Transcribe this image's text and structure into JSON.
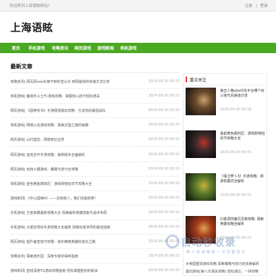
{
  "topbar": {
    "welcome": "欢迎来到上海语眩网站！",
    "links": [
      "注册",
      "|",
      "登录"
    ]
  },
  "site": {
    "name": "上海语眩"
  },
  "nav": [
    "首页",
    "手机游戏",
    "攻略资讯",
    "网页游戏",
    "游戏新闻",
    "单机游戏"
  ],
  "articles_section": {
    "title": "最新文章",
    "items": [
      {
        "title": "攻略资讯| 网页原neo先审不到你怎么办 到网最快的快速方法分享",
        "date": "2024-09-30 09:33"
      },
      {
        "title": "单机游戏| 魔塔环斗士FC游戏攻略：掌握核心技巧轻松通关",
        "date": "2024-09-30 09:33"
      },
      {
        "title": "网页游戏| 《圆神你书》手游网游激玩攻略：打造你的最强战队",
        "date": "2024-09-30 09:33"
      },
      {
        "title": "单机游戏| 网络火友游戏攻略：探索次盟之旅的秘籍",
        "date": "2024-09-30 09:33"
      },
      {
        "title": "网页游戏| 山村遗恋：网络奇幻边界",
        "date": "2024-09-30 09:33"
      },
      {
        "title": "网页游戏| 迪克全开手游攻略：最新版本全面解析",
        "date": "2024-09-30 09:33"
      },
      {
        "title": "网页游戏| 玩转火钢游戏：策略与技巧全攻略",
        "date": "2024-09-30 09:33"
      },
      {
        "title": "单机游戏| 金色黄金晨田区：游戏购物狂欢节攻略大全",
        "date": "2024-09-30 09:33"
      },
      {
        "title": "游戏新闻| 《中心圆西A》——治商放人，我们也能搞笑！",
        "date": "2024-09-30 09:33"
      },
      {
        "title": "手机游戏| 王者争霸最新攻略大全 探索解析英雄技能与战术布局",
        "date": "2024-09-30 09:33"
      },
      {
        "title": "手机游戏| 大富俭领好手游攻略大全最新 探索玩看世界的最佳指南",
        "date": "2024-09-30 09:33"
      },
      {
        "title": "网页游戏| 提升备查技巧攻略：快乐精英英雄的成长之路",
        "date": "2024-09-30 09:33"
      },
      {
        "title": "攻略资讯| 探索游乐园：深度专家的得到指南",
        "date": "2024-09-30 09:33"
      },
      {
        "title": "游戏新闻| 直线深度TG游戏攻略指南 轻松掌握胜利的秘诀",
        "date": "2024-09-30 09:33"
      }
    ]
  },
  "sidebar": {
    "title": "重点关注",
    "items": [
      {
        "title": "第五人格o0o代先平台哪个好 三级代充渠道分享",
        "date": "2024-09-30 09:16",
        "colors": [
          "#221a14",
          "#6a4a2c",
          "#c9a36a"
        ]
      },
      {
        "title": "金航黄色晨的区：游戏购物狂欢节攻略大全",
        "date": "2024-09-30 09:33",
        "colors": [
          "#0c0c10",
          "#3b2a2a",
          "#b8322b"
        ]
      },
      {
        "title": "《保卫萝卜3》手游攻略：新游机模式全解析",
        "date": "2024-09-30 09:33",
        "colors": [
          "#1e2a10",
          "#5a7a2a",
          "#c8b038"
        ]
      },
      {
        "title": "幻者调你魔兄见奥攻略: 探索英雄攻略全解析",
        "date": "2024-09-30 09:33",
        "colors": [
          "#3a1810",
          "#a23a1a",
          "#e0a050"
        ]
      }
    ],
    "extra": [
      "大帝国重现游戏攻略 探索策略与技巧的完美解析",
      "最旧游戏(第八乐通关攻略) 轻松通达，一拼攻略"
    ]
  },
  "watermark": {
    "main": "自动秒收录",
    "sub": "做 上 收 录   唯 快 一 次   流 量 增 长"
  }
}
